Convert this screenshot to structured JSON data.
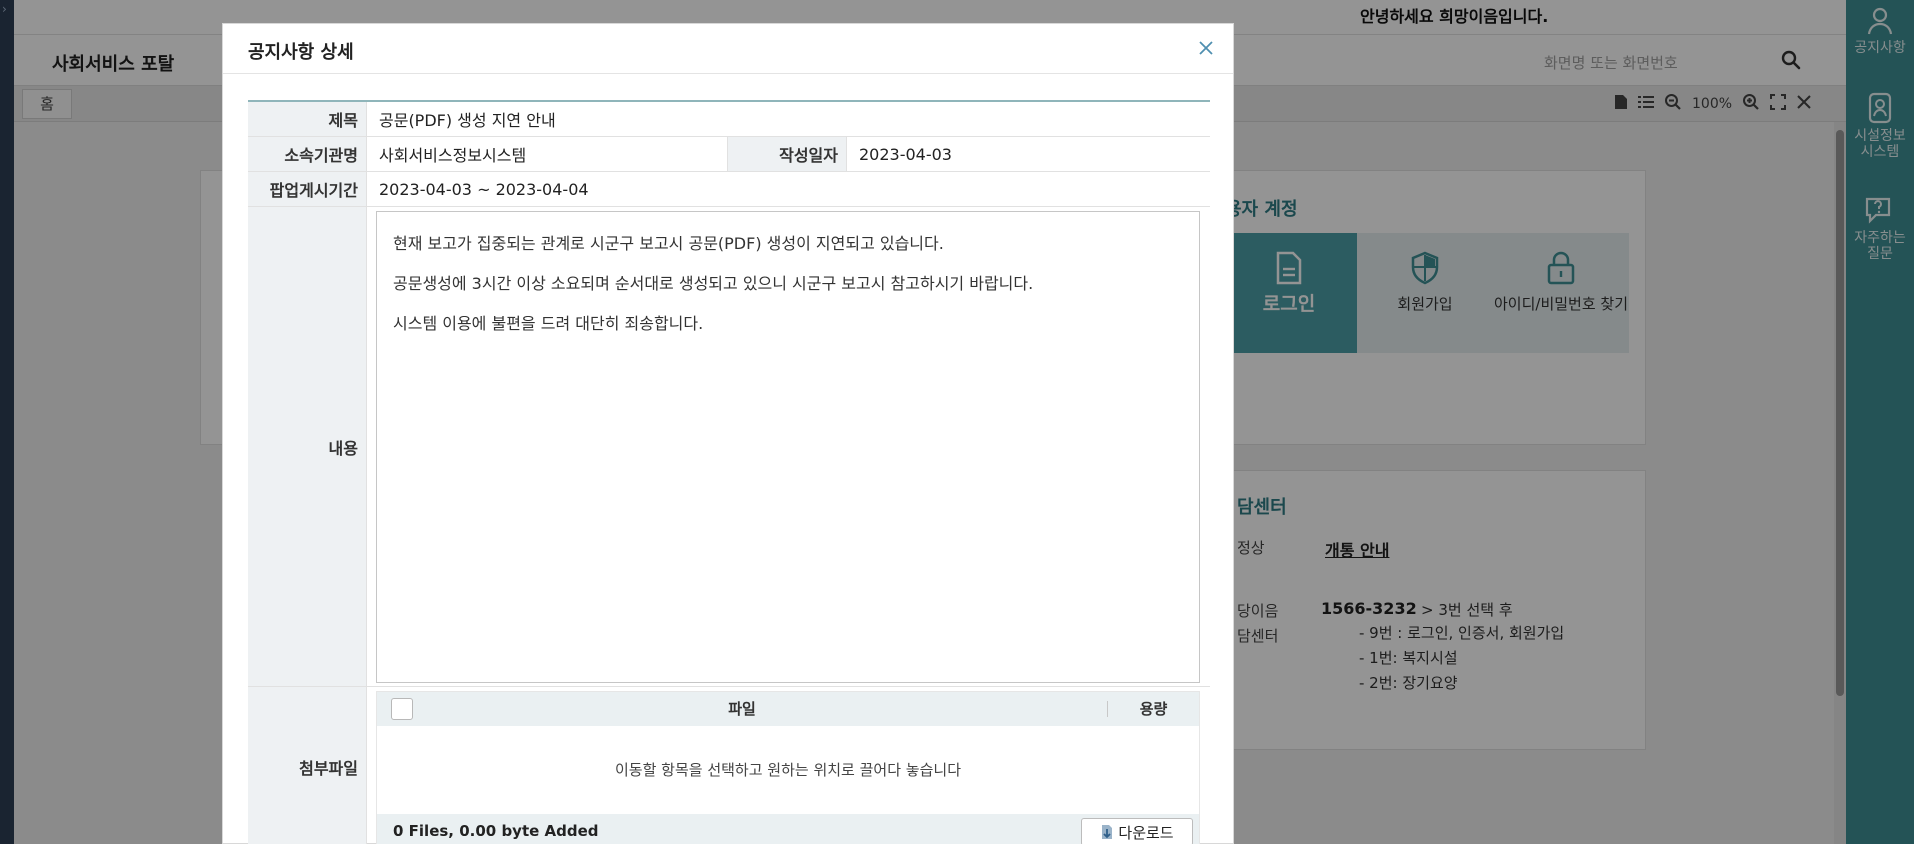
{
  "background": {
    "greeting": "안녕하세요 희망이음입니다.",
    "portal_title": "사회서비스 포탈",
    "search_placeholder": "화면명 또는 화면번호",
    "home_tab": "홈",
    "zoom_level": "100%",
    "login_heading": "용자 계정",
    "login_options": {
      "login": "로그인",
      "join": "회원가입",
      "find": "아이디/비밀번호 찾기"
    },
    "center": {
      "heading": "담센터",
      "row1_label": "정상",
      "open_link": "개통 안내",
      "row2_label_1": "당이음",
      "row2_label_2": "담센터",
      "phone": "1566-3232",
      "phone_after": "> 3번 선택 후",
      "menu": [
        "- 9번 : 로그인, 인증서, 회원가입",
        "- 1번: 복지시설",
        "- 2번: 장기요양"
      ]
    }
  },
  "quick_menu": [
    {
      "icon": "user-icon",
      "label": "공지사항"
    },
    {
      "icon": "facility-icon",
      "label": "시설정보시스템"
    },
    {
      "icon": "faq-icon",
      "label": "자주하는 질문"
    }
  ],
  "modal": {
    "title": "공지사항 상세",
    "labels": {
      "title": "제목",
      "org": "소속기관명",
      "date": "작성일자",
      "popup_period": "팝업게시기간",
      "content": "내용",
      "attach": "첨부파일"
    },
    "values": {
      "title": "공문(PDF) 생성 지연 안내",
      "org": "사회서비스정보시스템",
      "date": "2023-04-03",
      "popup_period": "2023-04-03 ~ 2023-04-04"
    },
    "content_lines": [
      "현재 보고가 집중되는 관계로 시군구 보고시 공문(PDF) 생성이 지연되고 있습니다.",
      "공문생성에 3시간 이상 소요되며 순서대로 생성되고 있으니 시군구 보고시 참고하시기 바랍니다.",
      "시스템 이용에 불편을 드려 대단히 죄송합니다."
    ],
    "attach": {
      "col_file": "파일",
      "col_size": "용량",
      "drop_hint": "이동할 항목을 선택하고 원하는 위치로 끌어다 놓습니다",
      "file_count": "0 Files, 0.00 byte Added",
      "download_label": "다운로드"
    }
  }
}
